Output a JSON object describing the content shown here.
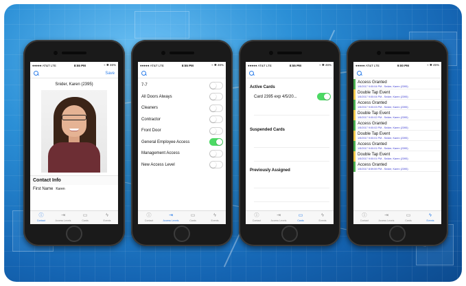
{
  "status": {
    "carrier": "●●●●● AT&T  LTE",
    "battery_icons": "⌁ ✱ "
  },
  "phones": [
    {
      "time": "8:55 PM",
      "battery": "46%",
      "nav_action": "Save",
      "contact_name": "Snider, Karen (2395)",
      "section_title": "Contact Info",
      "field_label": "First Name",
      "field_value": "Karen",
      "active_tab": 0
    },
    {
      "time": "8:55 PM",
      "battery": "46%",
      "levels": [
        {
          "name": "7-7",
          "on": false
        },
        {
          "name": "All Doors Always",
          "on": false
        },
        {
          "name": "Cleaners",
          "on": false
        },
        {
          "name": "Contractor",
          "on": false
        },
        {
          "name": "Front Door",
          "on": false
        },
        {
          "name": "General Employee Access",
          "on": true
        },
        {
          "name": "Management Access",
          "on": false
        },
        {
          "name": "New Access Level",
          "on": false
        }
      ],
      "active_tab": 1
    },
    {
      "time": "8:55 PM",
      "battery": "46%",
      "active_cards_title": "Active Cards",
      "active_card": "Card 2395 exp 4/5/20...",
      "active_card_on": true,
      "suspended_title": "Suspended Cards",
      "previous_title": "Previously Assigned",
      "active_tab": 2
    },
    {
      "time": "9:00 PM",
      "battery": "45%",
      "events": [
        {
          "title": "Access Granted",
          "detail": "1/5/2017 9:00:04 PM - Snider, Karen (2395)",
          "type": "granted"
        },
        {
          "title": "Double Tap Event",
          "detail": "1/5/2017 9:00:04 PM - Snider, Karen (2395)",
          "type": "double"
        },
        {
          "title": "Access Granted",
          "detail": "1/5/2017 9:00:03 PM - Snider, Karen (2395)",
          "type": "granted"
        },
        {
          "title": "Double Tap Event",
          "detail": "1/5/2017 9:00:02 PM - Snider, Karen (2395)",
          "type": "double"
        },
        {
          "title": "Access Granted",
          "detail": "1/5/2017 9:00:02 PM - Snider, Karen (2395)",
          "type": "granted"
        },
        {
          "title": "Double Tap Event",
          "detail": "1/5/2017 9:00:01 PM - Snider, Karen (2395)",
          "type": "double"
        },
        {
          "title": "Access Granted",
          "detail": "1/5/2017 9:00:01 PM - Snider, Karen (2395)",
          "type": "granted"
        },
        {
          "title": "Double Tap Event",
          "detail": "1/5/2017 9:00:01 PM - Snider, Karen (2395)",
          "type": "double"
        },
        {
          "title": "Access Granted",
          "detail": "1/5/2017 8:59:59 PM - Snider, Karen (2395)",
          "type": "granted"
        }
      ],
      "active_tab": 3
    }
  ],
  "tabs": [
    {
      "label": "Contact",
      "icon": "info-icon",
      "glyph": "ⓘ"
    },
    {
      "label": "Access Levels",
      "icon": "door-icon",
      "glyph": "⇥"
    },
    {
      "label": "Cards",
      "icon": "card-icon",
      "glyph": "▭"
    },
    {
      "label": "Events",
      "icon": "lightning-icon",
      "glyph": "ϟ"
    }
  ],
  "colors": {
    "accent": "#2b7de9",
    "toggle_on": "#4cd964",
    "granted": "#4caf50",
    "double_tap": "#f2c94c",
    "event_detail": "#3a3ad0"
  }
}
